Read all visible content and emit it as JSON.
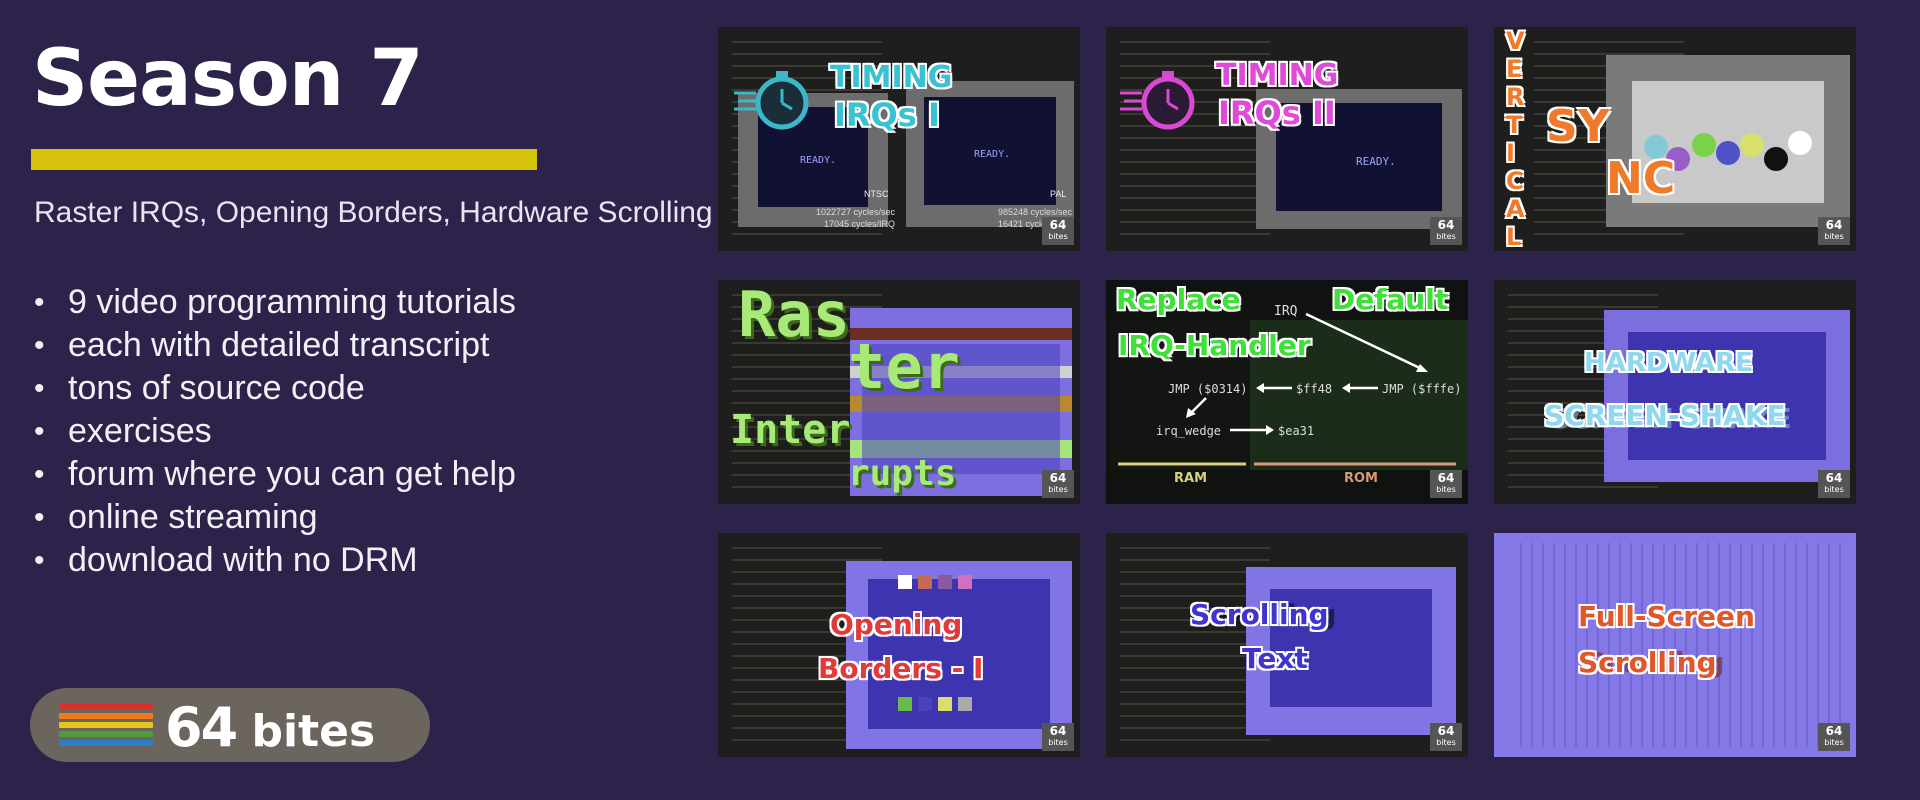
{
  "header": {
    "title": "Season 7",
    "subtitle": "Raster IRQs, Opening Borders, Hardware Scrolling"
  },
  "features": [
    "9 video programming tutorials",
    "each with detailed transcript",
    "tons of source code",
    "exercises",
    "forum where you can get help",
    "online streaming",
    "download with no DRM"
  ],
  "brand": {
    "number": "64",
    "word": "bites",
    "stripe_colors": [
      "#d9322c",
      "#ee7b1f",
      "#e8c61b",
      "#4f9a3b",
      "#2f7fc4"
    ]
  },
  "colors": {
    "background": "#2d2249",
    "accent_bar": "#d5c30a"
  },
  "episodes": [
    {
      "id": "ep1",
      "line1": "TIMING",
      "line2": "IRQs I",
      "icon": "stopwatch-icon",
      "ntsc_label": "NTSC",
      "ntsc_cycles": "1022727 cycles/sec",
      "ntsc_irq": "17045 cycles/IRQ",
      "pal_label": "PAL",
      "pal_cycles": "985248 cycles/sec",
      "pal_irq": "16421 cycles/IRQ",
      "ready": "READY."
    },
    {
      "id": "ep2",
      "line1": "TIMING",
      "line2": "IRQs II",
      "icon": "stopwatch-icon",
      "ready": "READY."
    },
    {
      "id": "ep3",
      "vertical": "VERTICAL",
      "sync1": "SY",
      "sync2": "NC"
    },
    {
      "id": "ep4",
      "w1": "Ras",
      "w2": "ter",
      "w3": "Inter",
      "w4": "rupts"
    },
    {
      "id": "ep5",
      "t1": "Replace",
      "t2": "Default",
      "t3": "IRQ-Handler",
      "irq": "IRQ",
      "jmp1": "JMP ($0314)",
      "ff48": "$ff48",
      "jmp2": "JMP ($fffe)",
      "wedge": "irq_wedge",
      "ea31": "$ea31",
      "ram": "RAM",
      "rom": "ROM"
    },
    {
      "id": "ep6",
      "line1": "HARDWARE",
      "line2": "SCREEN-SHAKE"
    },
    {
      "id": "ep7",
      "line1": "Opening",
      "line2": "Borders - I"
    },
    {
      "id": "ep8",
      "line1": "Scrolling",
      "line2": "Text"
    },
    {
      "id": "ep9",
      "line1": "Full-Screen",
      "line2": "Scrolling"
    }
  ],
  "badge": {
    "num": "64",
    "word": "bites"
  }
}
